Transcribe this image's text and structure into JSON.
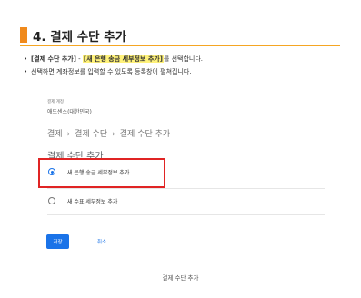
{
  "section": {
    "title": "4. 결제 수단 추가"
  },
  "bullets": {
    "b1": {
      "text1": "[결제 수단 추가]",
      "text2": " - ",
      "highlight": "[새 은행 송금 세부정보 추가]",
      "text3": "를 선택합니다."
    },
    "b2": {
      "text": "선택하면 계좌정보를 입력할 수 있도록 등록창이 펼쳐집니다."
    }
  },
  "form": {
    "account_label": "결제 계정",
    "account_name": "애드센스(대한민국)",
    "breadcrumb": [
      "결제",
      "결제 수단",
      "결제 수단 추가"
    ],
    "heading": "결제 수단 추가",
    "options": [
      {
        "label": "새 은행 송금 세부정보 추가",
        "checked": true
      },
      {
        "label": "새 수표 세부정보 추가",
        "checked": false
      }
    ],
    "save_label": "저장",
    "cancel_label": "취소"
  },
  "caption": "결제 수단 추가",
  "colors": {
    "accent": "#f08a1c",
    "highlight": "#fff27a",
    "primary": "#1a73e8",
    "callout": "#e02424"
  },
  "icons": {
    "checked": "radio-checked-icon",
    "unchecked": "radio-unchecked-icon",
    "bullet": "bullet-icon"
  }
}
